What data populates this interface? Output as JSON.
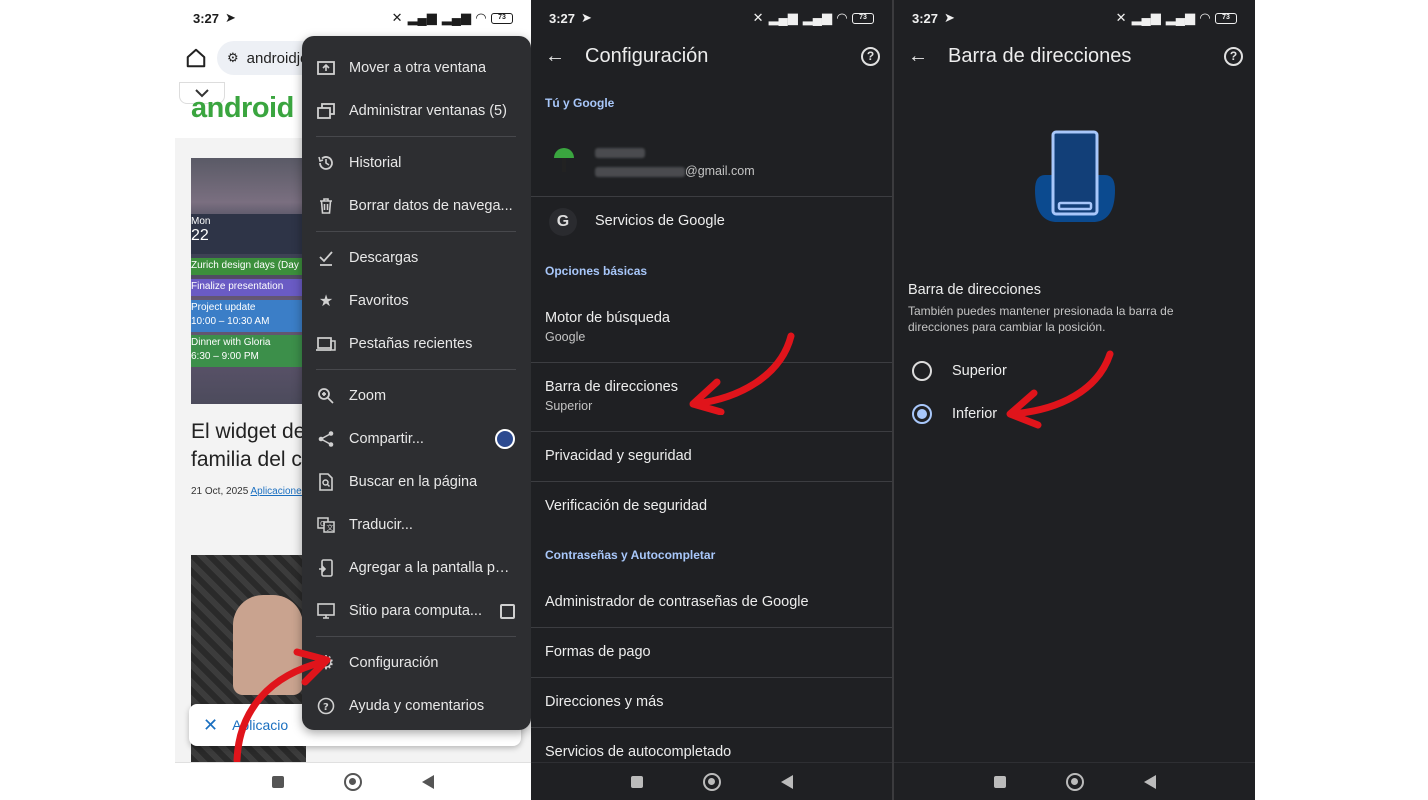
{
  "status_bar": {
    "time": "3:27",
    "battery": "73"
  },
  "panel1": {
    "url": "androidje",
    "site_logo": "android",
    "calendar": {
      "day": "Mon",
      "date": "22",
      "events": [
        "Zurich design days (Day",
        "Finalize presentation",
        "Project update",
        "10:00 – 10:30 AM",
        "Dinner with Gloria",
        "6:30 – 9:00 PM"
      ]
    },
    "article_title_line1": "El widget de",
    "article_title_line2": "familia del c",
    "article_date": "21 Oct, 2025",
    "article_category": "Aplicaciones",
    "bottom_bar_text": "Aplicacio",
    "menu": {
      "items": [
        {
          "label": "Mover a otra ventana",
          "icon": "move-window-icon"
        },
        {
          "label": "Administrar ventanas (5)",
          "icon": "windows-icon"
        },
        {
          "label": "Historial",
          "icon": "history-icon"
        },
        {
          "label": "Borrar datos de navega...",
          "icon": "trash-icon"
        },
        {
          "label": "Descargas",
          "icon": "download-check-icon"
        },
        {
          "label": "Favoritos",
          "icon": "star-icon"
        },
        {
          "label": "Pestañas recientes",
          "icon": "devices-icon"
        },
        {
          "label": "Zoom",
          "icon": "zoom-icon"
        },
        {
          "label": "Compartir...",
          "icon": "share-icon"
        },
        {
          "label": "Buscar en la página",
          "icon": "find-in-page-icon"
        },
        {
          "label": "Traducir...",
          "icon": "translate-icon"
        },
        {
          "label": "Agregar a la pantalla pri...",
          "icon": "add-to-home-icon"
        },
        {
          "label": "Sitio para computa...",
          "icon": "desktop-icon"
        },
        {
          "label": "Configuración",
          "icon": "gear-icon"
        },
        {
          "label": "Ayuda y comentarios",
          "icon": "help-icon"
        }
      ]
    }
  },
  "panel2": {
    "title": "Configuración",
    "section_you": "Tú y Google",
    "account_email_suffix": "@gmail.com",
    "google_services": "Servicios de Google",
    "section_basic": "Opciones básicas",
    "rows": [
      {
        "title": "Motor de búsqueda",
        "subtitle": "Google"
      },
      {
        "title": "Barra de direcciones",
        "subtitle": "Superior"
      },
      {
        "title": "Privacidad y seguridad"
      },
      {
        "title": "Verificación de seguridad"
      }
    ],
    "section_passwords": "Contraseñas y Autocompletar",
    "rows2": [
      {
        "title": "Administrador de contraseñas de Google"
      },
      {
        "title": "Formas de pago"
      },
      {
        "title": "Direcciones y más"
      },
      {
        "title": "Servicios de autocompletado"
      }
    ]
  },
  "panel3": {
    "title": "Barra de direcciones",
    "option_title": "Barra de direcciones",
    "option_desc": "También puedes mantener presionada la barra de direcciones para cambiar la posición.",
    "options": [
      {
        "label": "Superior",
        "selected": false
      },
      {
        "label": "Inferior",
        "selected": true
      }
    ]
  },
  "colors": {
    "accent": "#a8c7fa",
    "dark_bg": "#1f2023",
    "menu_bg": "#2d2e31",
    "logo_green": "#3aa53f",
    "annotation_red": "#e0141b"
  }
}
